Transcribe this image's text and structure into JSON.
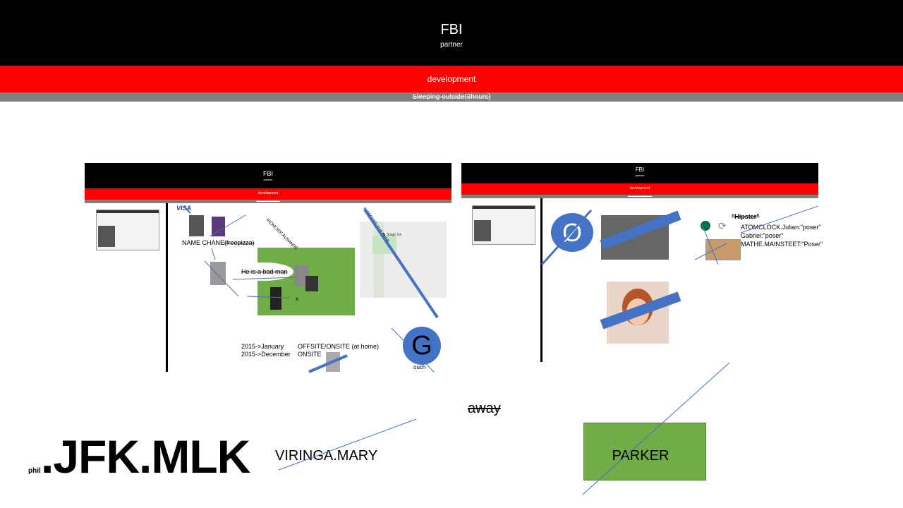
{
  "banner": {
    "title": "FBI",
    "subtitle": "partner",
    "dev": "development",
    "sleep": "Sleeping outside(3hours)"
  },
  "slide1": {
    "title": "FBI",
    "subtitle": "partner",
    "dev": "development",
    "sleep": "Sleeping outside(3hours)",
    "visa": "VISA",
    "name_change": "NAME CHANE",
    "free_pizza": "(freepizza)",
    "bad_man": "He is a bad man",
    "x_mark": "x",
    "diag1": "IHOMOIDF.AUSANDE",
    "diag2": "IHOMOIDF.AUSANDE",
    "map_label": "Stage Inn",
    "timeline": [
      "2015->January",
      "2015->December"
    ],
    "onsite": [
      "OFFSITE/ONSITE (at home)",
      "ONSITE"
    ],
    "g_letter": "G",
    "ouch": "ouch"
  },
  "slide2": {
    "title": "FBI",
    "subtitle": "partner",
    "dev": "development",
    "sleep": "Sleeping outside(3hours)",
    "o_letter": "Ø",
    "hipster": "\"Hipster\"",
    "quotes": [
      "ATOMCLOCK.Julian:\"poser\"",
      "Gabriel:\"poser\"",
      "MATHE.MAINSTEET:\"Poser\""
    ]
  },
  "bottom": {
    "away": "away",
    "phil": "phil",
    "jfk": ".JFK.MLK",
    "viringa": "VIRINGA.MARY",
    "parker": "PARKER"
  }
}
